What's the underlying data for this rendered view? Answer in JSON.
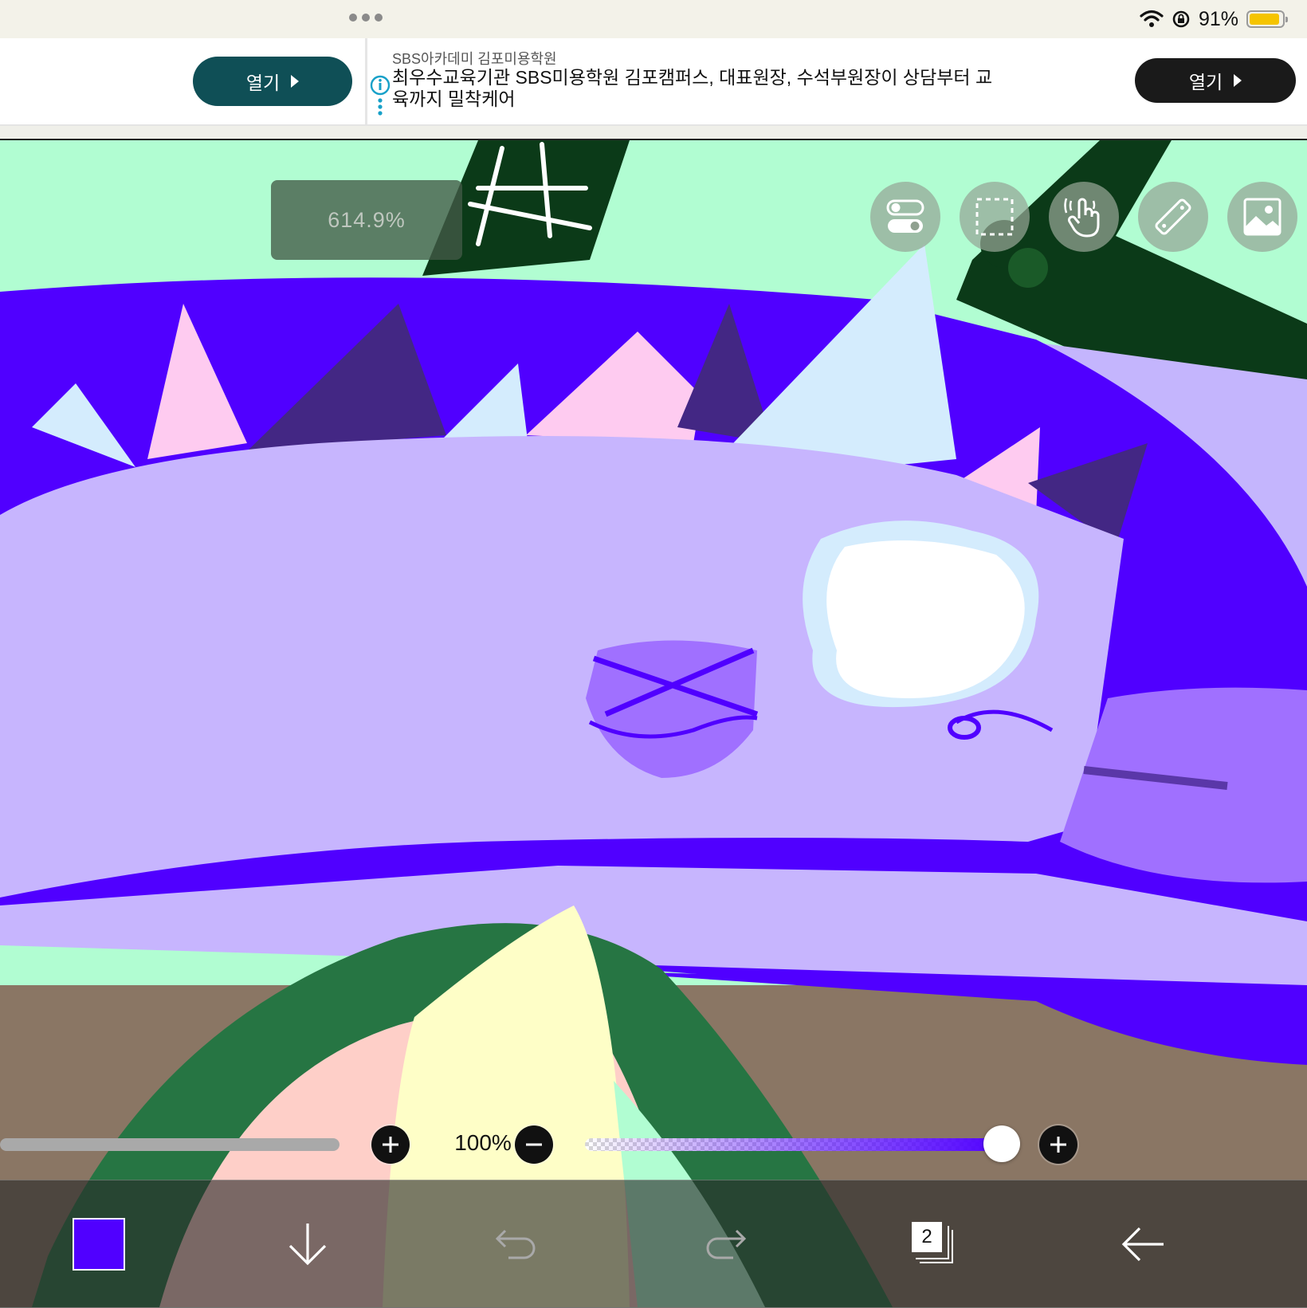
{
  "status_bar": {
    "battery_text": "91%",
    "battery_level": 0.91,
    "battery_color": "#f5c400"
  },
  "ad": {
    "left_button_label": "열기",
    "sponsor": "SBS아카데미 김포미용학원",
    "headline": "최우수교육기관 SBS미용학원 김포캠퍼스, 대표원장, 수석부원장이 상담부터 교육까지 밀착케어",
    "right_button_label": "열기",
    "teal_color": "#0f4f56"
  },
  "canvas": {
    "zoom_level": "614.9%"
  },
  "tools": {
    "icons": [
      "toggle-icon",
      "selection-icon",
      "touch-gesture-icon",
      "ruler-icon",
      "image-icon"
    ]
  },
  "brush": {
    "size_label": "100%",
    "opacity_level": 1.0,
    "current_color": "#5000ff"
  },
  "toolbar": {
    "layers_count": "2",
    "icons": [
      "color-swatch",
      "download-arrow-icon",
      "undo-icon",
      "redo-icon",
      "layers-icon",
      "back-arrow-icon"
    ]
  }
}
